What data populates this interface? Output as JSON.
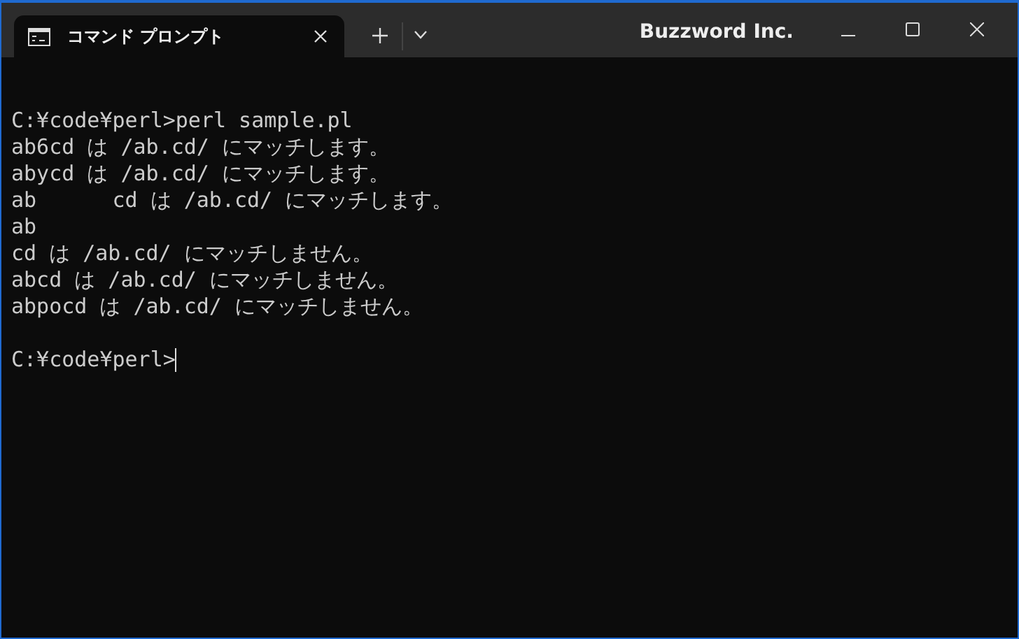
{
  "window": {
    "tab_title": "コマンド プロンプト",
    "app_name": "Buzzword Inc."
  },
  "console": {
    "lines": [
      {
        "kind": "text",
        "text": "C:¥code¥perl>perl sample.pl"
      },
      {
        "kind": "text",
        "text": "ab6cd は /ab.cd/ にマッチします。"
      },
      {
        "kind": "text",
        "text": "abycd は /ab.cd/ にマッチします。"
      },
      {
        "kind": "text",
        "text": "ab      cd は /ab.cd/ にマッチします。"
      },
      {
        "kind": "text",
        "text": "ab"
      },
      {
        "kind": "text",
        "text": "cd は /ab.cd/ にマッチしません。"
      },
      {
        "kind": "text",
        "text": "abcd は /ab.cd/ にマッチしません。"
      },
      {
        "kind": "text",
        "text": "abpocd は /ab.cd/ にマッチしません。"
      },
      {
        "kind": "blank"
      },
      {
        "kind": "prompt",
        "text": "C:¥code¥perl>"
      }
    ]
  }
}
